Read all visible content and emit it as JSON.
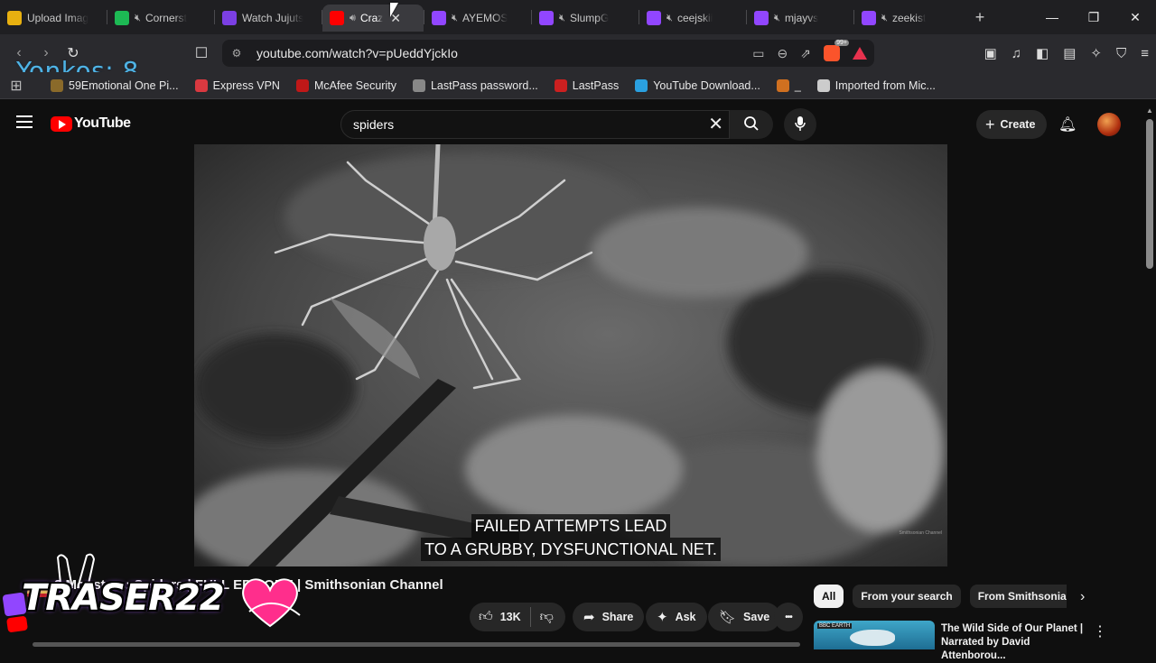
{
  "browser": {
    "tabs": [
      {
        "title": "Upload Imag",
        "icon": "upload-icon",
        "color": "#e8b010",
        "muted": false,
        "active": false
      },
      {
        "title": "Cornerst",
        "icon": "spotify-icon",
        "color": "#1db954",
        "muted": true,
        "active": false
      },
      {
        "title": "Watch Jujuts",
        "icon": "play-triangle-icon",
        "color": "#7b3fe4",
        "muted": false,
        "active": false
      },
      {
        "title": "Craz",
        "icon": "youtube-icon",
        "color": "#ff0000",
        "muted": false,
        "speaker": true,
        "active": true
      },
      {
        "title": "AYEMOS",
        "icon": "twitch-icon",
        "color": "#9146ff",
        "muted": true,
        "active": false
      },
      {
        "title": "SlumpG",
        "icon": "twitch-icon",
        "color": "#9146ff",
        "muted": true,
        "active": false
      },
      {
        "title": "ceejskii",
        "icon": "twitch-icon",
        "color": "#9146ff",
        "muted": true,
        "active": false
      },
      {
        "title": "mjayvs",
        "icon": "twitch-icon",
        "color": "#9146ff",
        "muted": true,
        "active": false
      },
      {
        "title": "zeekist",
        "icon": "twitch-icon",
        "color": "#9146ff",
        "muted": true,
        "active": false
      }
    ],
    "new_tab": "+",
    "window_controls": {
      "minimize": "—",
      "restore": "❐",
      "close": "✕"
    },
    "url": "youtube.com/watch?v=pUeddYjckIo",
    "shields_count": "99+",
    "bookmarks": [
      {
        "label": "59Emotional One Pi...",
        "color": "#8a6a2a"
      },
      {
        "label": "Express VPN",
        "color": "#da3940"
      },
      {
        "label": "McAfee Security",
        "color": "#c01818"
      },
      {
        "label": "LastPass password...",
        "color": "#888888"
      },
      {
        "label": "LastPass",
        "color": "#cc2020"
      },
      {
        "label": "YouTube Download...",
        "color": "#2aa0e0"
      },
      {
        "label": "_",
        "color": "#d07020"
      },
      {
        "label": "Imported from Mic...",
        "color": "#cccccc"
      }
    ]
  },
  "stream_overlay": {
    "counter": "Yonkos: 8",
    "streamer_name": "TRASER22"
  },
  "youtube": {
    "logo_text": "YouTube",
    "search_value": "spiders",
    "create_label": "Create",
    "video": {
      "caption_line1": "FAILED ATTEMPTS LEAD",
      "caption_line2": "TO A GRUBBY, DYSFUNCTIONAL NET.",
      "watermark": "Smithsonian Channel",
      "title": "2 Monsters: Spiders | FULL EPISODE | Smithsonian Channel"
    },
    "actions": {
      "likes": "13K",
      "share": "Share",
      "ask": "Ask",
      "save": "Save",
      "more": "•••"
    },
    "chips": [
      {
        "label": "All",
        "selected": true
      },
      {
        "label": "From your search",
        "selected": false
      },
      {
        "label": "From Smithsonian Channel",
        "selected": false
      }
    ],
    "recommendation": {
      "badge": "BBC EARTH",
      "title": "The Wild Side of Our Planet | Narrated by David Attenborou..."
    }
  }
}
